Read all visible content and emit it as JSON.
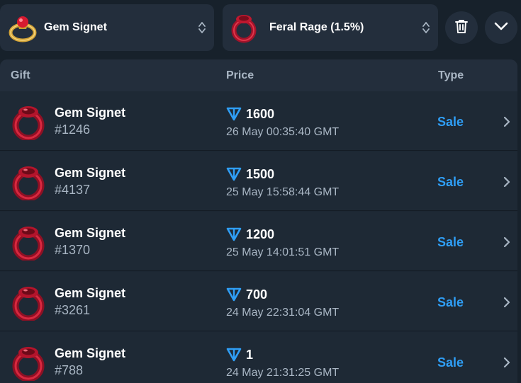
{
  "filters": {
    "gift_select": {
      "label": "Gem Signet",
      "icon": "gold-ring-icon"
    },
    "model_select": {
      "label": "Feral Rage (1.5%)",
      "icon": "red-ring-icon"
    },
    "clear_icon": "trash-icon",
    "expand_icon": "chevron-down-icon"
  },
  "table": {
    "columns": {
      "gift": "Gift",
      "price": "Price",
      "type": "Type"
    },
    "rows": [
      {
        "name": "Gem Signet",
        "number": "#1246",
        "price": "1600",
        "date": "26 May 00:35:40 GMT",
        "type": "Sale"
      },
      {
        "name": "Gem Signet",
        "number": "#4137",
        "price": "1500",
        "date": "25 May 15:58:44 GMT",
        "type": "Sale"
      },
      {
        "name": "Gem Signet",
        "number": "#1370",
        "price": "1200",
        "date": "25 May 14:01:51 GMT",
        "type": "Sale"
      },
      {
        "name": "Gem Signet",
        "number": "#3261",
        "price": "700",
        "date": "24 May 22:31:04 GMT",
        "type": "Sale"
      },
      {
        "name": "Gem Signet",
        "number": "#788",
        "price": "1",
        "date": "24 May 21:31:25 GMT",
        "type": "Sale"
      }
    ]
  },
  "colors": {
    "background": "#17212b",
    "panel": "#232e3c",
    "row": "#1e2935",
    "accent": "#2f9ef5",
    "muted_text": "#a9b6c4",
    "ring_red": "#c0182f"
  }
}
